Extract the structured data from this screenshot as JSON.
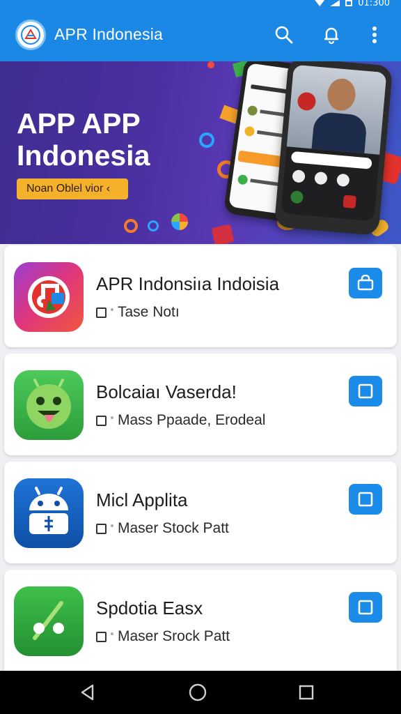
{
  "status_bar": {
    "time": "01:300"
  },
  "app_bar": {
    "title": "APR Indonesia",
    "icons": [
      "app-logo-icon",
      "search-icon",
      "notifications-icon",
      "more-vert-icon"
    ]
  },
  "banner": {
    "title_line1": "APP APP",
    "title_line2": "Indonesia",
    "cta_label": "Noan Oblel vior ‹"
  },
  "apps": [
    {
      "name": "APR Indonsiıa Indoisia",
      "meta": "Tase Notı",
      "icon": "music-note-app-icon",
      "action_icon": "shopping-bag-icon"
    },
    {
      "name": "Bolcaiaı Vaserda!",
      "meta": "Mass Ppaade, Erodeal",
      "icon": "android-face-app-icon",
      "action_icon": "square-icon"
    },
    {
      "name": "Micl Applita",
      "meta": "Maser Stock Patt",
      "icon": "android-robot-app-icon",
      "action_icon": "square-icon"
    },
    {
      "name": "Spdotia Easx",
      "meta": "Maser Srock Patt",
      "icon": "percent-app-icon",
      "action_icon": "square-icon"
    }
  ],
  "colors": {
    "primary": "#1b88e6",
    "accent": "#f5b12a",
    "nav_bg": "#000000"
  },
  "nav_bar": {
    "icons": [
      "back-icon",
      "home-icon",
      "recents-icon"
    ]
  }
}
